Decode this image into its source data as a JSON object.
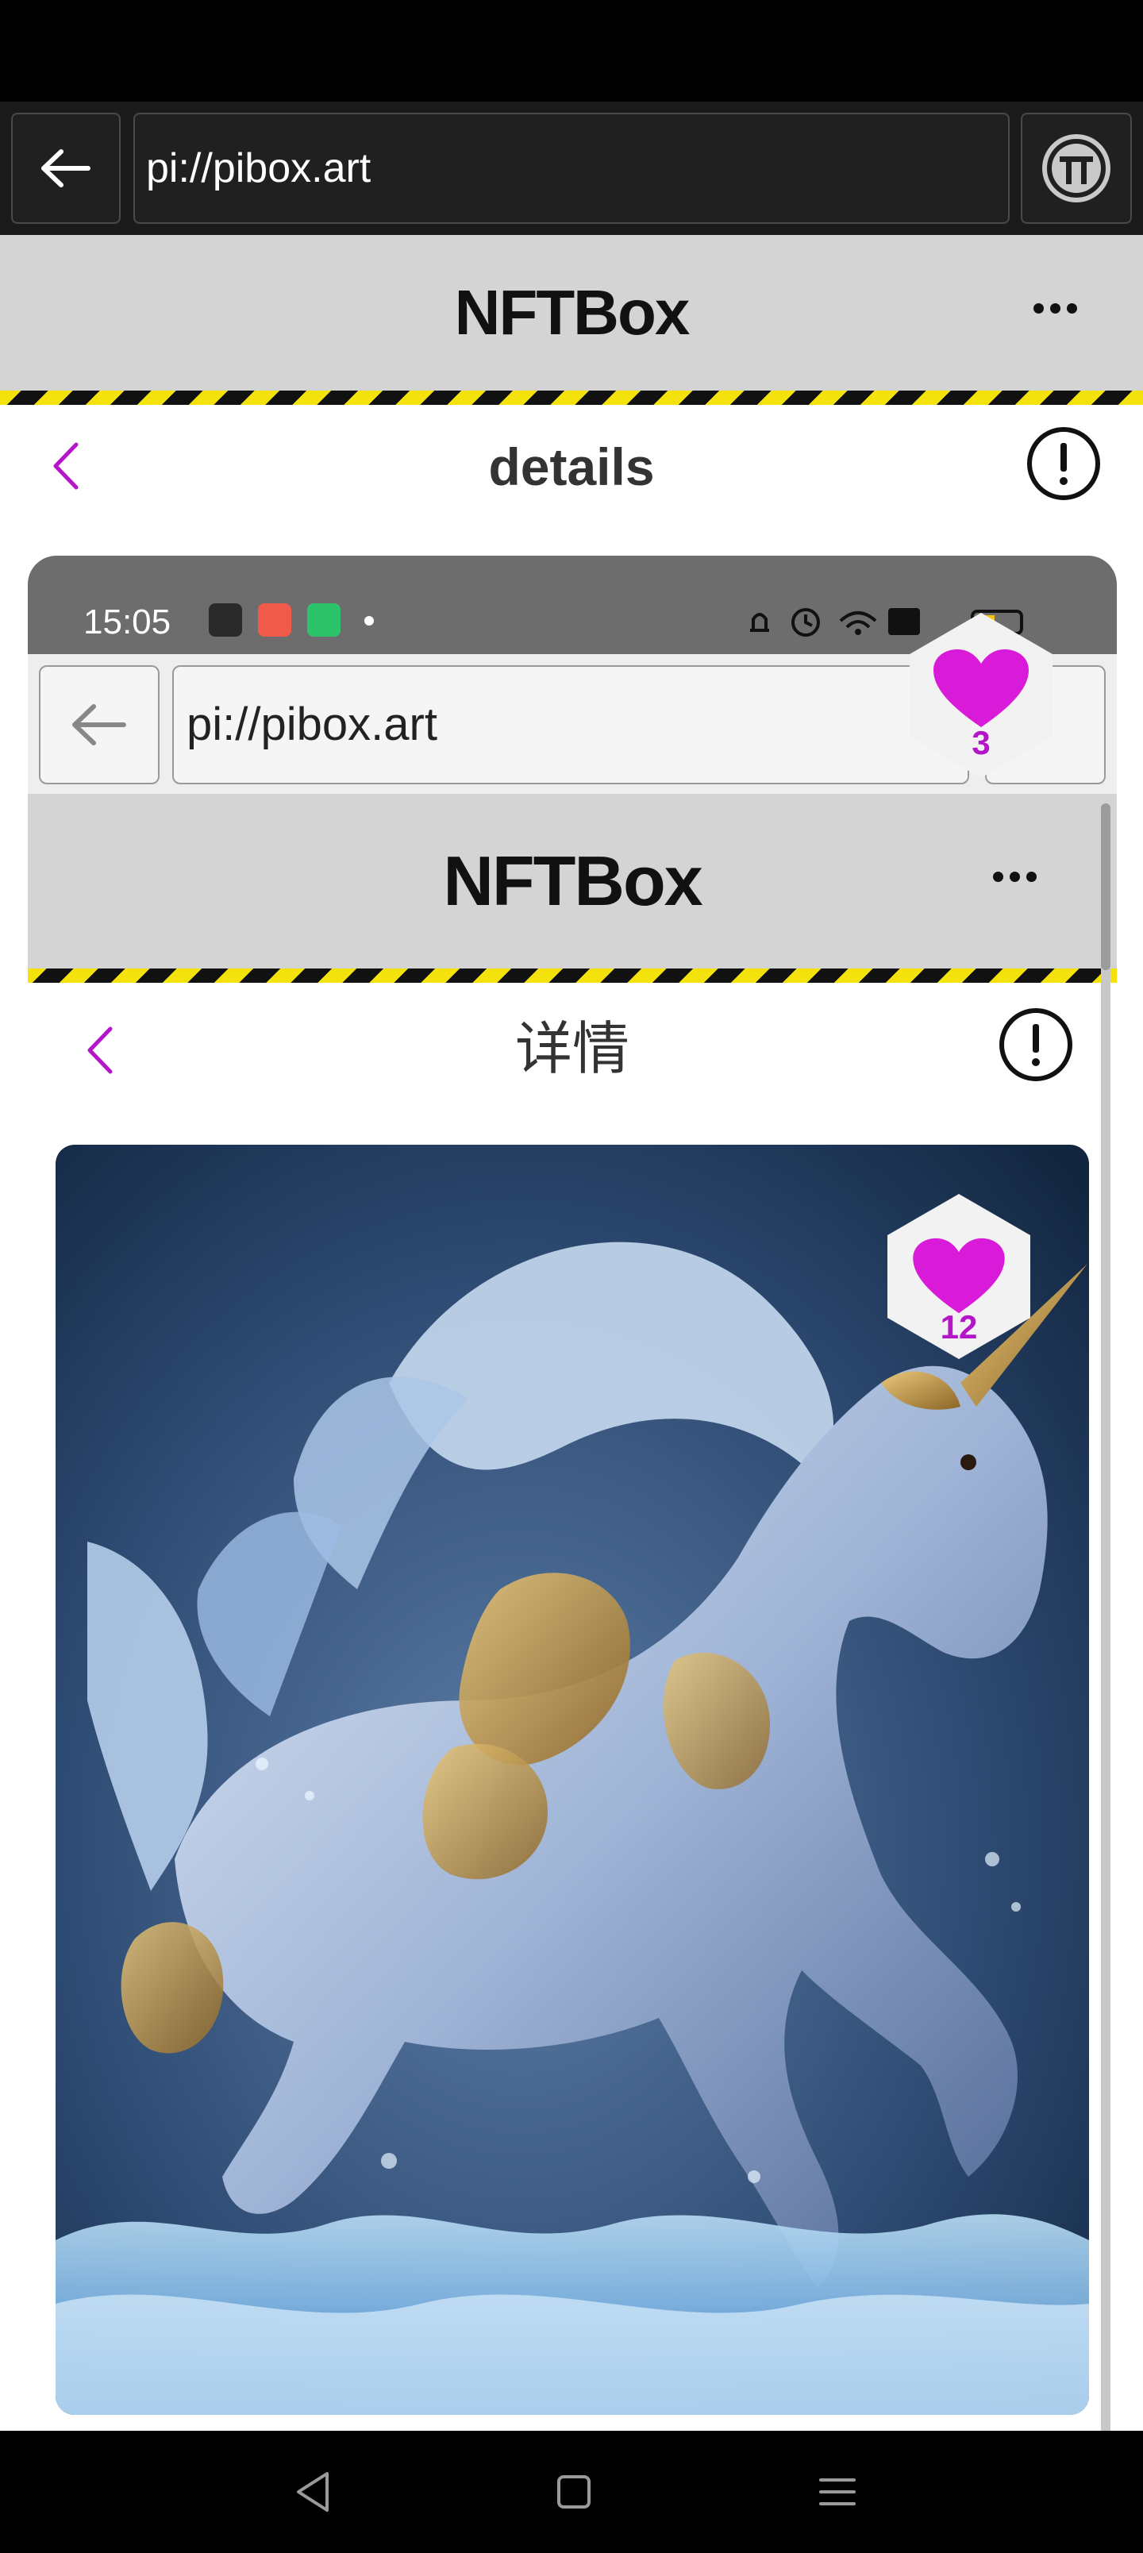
{
  "browser": {
    "url": "pi://pibox.art"
  },
  "app": {
    "title": "NFTBox"
  },
  "page": {
    "title": "details"
  },
  "screenshot": {
    "time": "15:05",
    "browser_url": "pi://pibox.art",
    "app_title": "NFTBox",
    "page_title": "详情",
    "card_likes": "3",
    "nft_likes": "12"
  },
  "icons": {
    "back": "arrow-left-icon",
    "pi": "pi-network-icon",
    "more": "more-horizontal-icon",
    "info": "info-circle-icon",
    "like": "heart-icon",
    "nav_back": "triangle-back-icon",
    "nav_home": "square-home-icon",
    "nav_menu": "menu-lines-icon"
  },
  "colors": {
    "accent": "#b515c9",
    "heart": "#d91ad8",
    "stripe_yellow": "#f4e20c",
    "header_gray": "#d4d4d4"
  }
}
